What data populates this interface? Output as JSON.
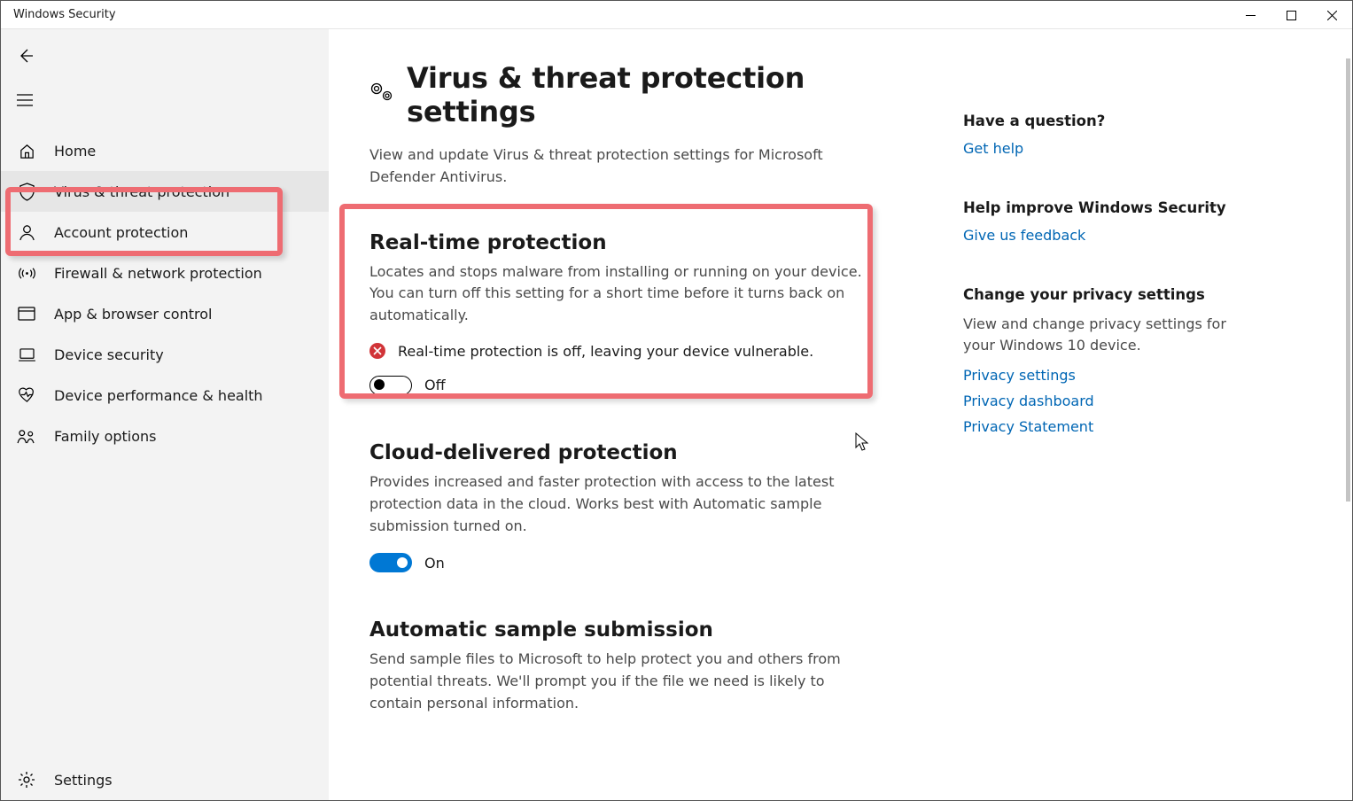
{
  "window": {
    "title": "Windows Security"
  },
  "sidebar": {
    "items": [
      {
        "label": "Home"
      },
      {
        "label": "Virus & threat protection"
      },
      {
        "label": "Account protection"
      },
      {
        "label": "Firewall & network protection"
      },
      {
        "label": "App & browser control"
      },
      {
        "label": "Device security"
      },
      {
        "label": "Device performance & health"
      },
      {
        "label": "Family options"
      }
    ],
    "settings_label": "Settings"
  },
  "page": {
    "title": "Virus & threat protection settings",
    "subtitle": "View and update Virus & threat protection settings for Microsoft Defender Antivirus."
  },
  "sections": {
    "realtime": {
      "title": "Real-time protection",
      "desc": "Locates and stops malware from installing or running on your device. You can turn off this setting for a short time before it turns back on automatically.",
      "warning": "Real-time protection is off, leaving your device vulnerable.",
      "toggle_state": "Off"
    },
    "cloud": {
      "title": "Cloud-delivered protection",
      "desc": "Provides increased and faster protection with access to the latest protection data in the cloud. Works best with Automatic sample submission turned on.",
      "toggle_state": "On"
    },
    "sample": {
      "title": "Automatic sample submission",
      "desc": "Send sample files to Microsoft to help protect you and others from potential threats. We'll prompt you if the file we need is likely to contain personal information."
    }
  },
  "side": {
    "question": {
      "title": "Have a question?",
      "link": "Get help"
    },
    "improve": {
      "title": "Help improve Windows Security",
      "link": "Give us feedback"
    },
    "privacy": {
      "title": "Change your privacy settings",
      "desc": "View and change privacy settings for your Windows 10 device.",
      "links": [
        "Privacy settings",
        "Privacy dashboard",
        "Privacy Statement"
      ]
    }
  }
}
